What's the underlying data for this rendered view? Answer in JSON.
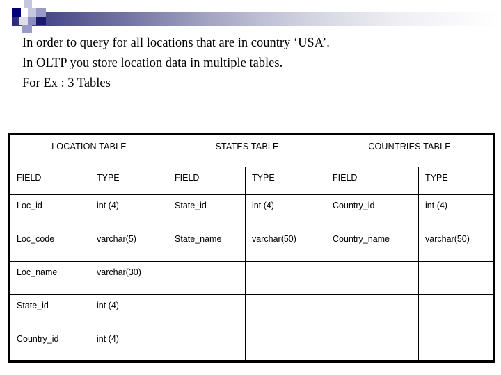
{
  "banner": {
    "gradient_from": "#2a2a72",
    "gradient_to": "#ffffff",
    "accent_dark": "#00007a",
    "accent_mid": "#8c8cc4",
    "accent_light": "#c6c6de"
  },
  "body_text": {
    "lines": [
      "In order to query for all locations that are in country ‘USA’.",
      "In OLTP you store location data in multiple tables.",
      "For Ex : 3 Tables"
    ]
  },
  "table": {
    "group_headers": [
      "LOCATION TABLE",
      "STATES TABLE",
      "COUNTRIES TABLE"
    ],
    "column_headers": [
      "FIELD",
      "TYPE",
      "FIELD",
      "TYPE",
      "FIELD",
      "TYPE"
    ],
    "rows": [
      [
        "Loc_id",
        "int (4)",
        "State_id",
        "int (4)",
        "Country_id",
        "int (4)"
      ],
      [
        "Loc_code",
        "varchar(5)",
        "State_name",
        "varchar(50)",
        "Country_name",
        "varchar(50)"
      ],
      [
        "Loc_name",
        "varchar(30)",
        "",
        "",
        "",
        ""
      ],
      [
        "State_id",
        "int (4)",
        "",
        "",
        "",
        ""
      ],
      [
        "Country_id",
        "int (4)",
        "",
        "",
        "",
        ""
      ]
    ]
  }
}
